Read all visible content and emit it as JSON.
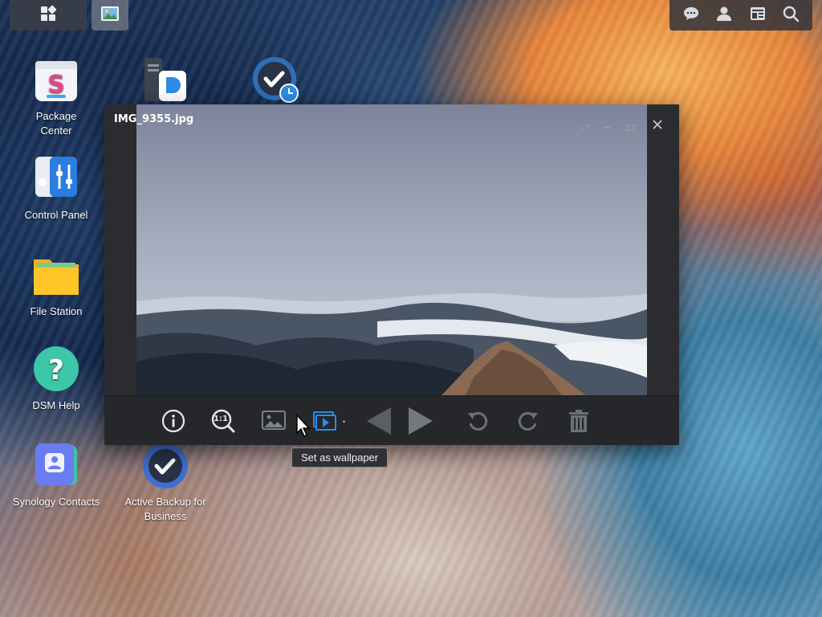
{
  "window": {
    "title": "IMG_9355.jpg"
  },
  "desktop_icons": [
    {
      "label": "Package\nCenter",
      "line1": "Package",
      "line2": "Center"
    },
    {
      "label": "Control Panel"
    },
    {
      "label": "File Station"
    },
    {
      "label": "DSM Help"
    },
    {
      "label": "Synology Contacts"
    },
    {
      "label_line1": "Active Backup for",
      "label_line2": "Business"
    }
  ],
  "toolbar": {
    "tooltip": "Set as wallpaper",
    "actual_size_label": "1:1"
  },
  "colors": {
    "accent": "#2d8ce6",
    "window_bg": "#2a2c30",
    "toolbar_bg": "#25272b"
  }
}
